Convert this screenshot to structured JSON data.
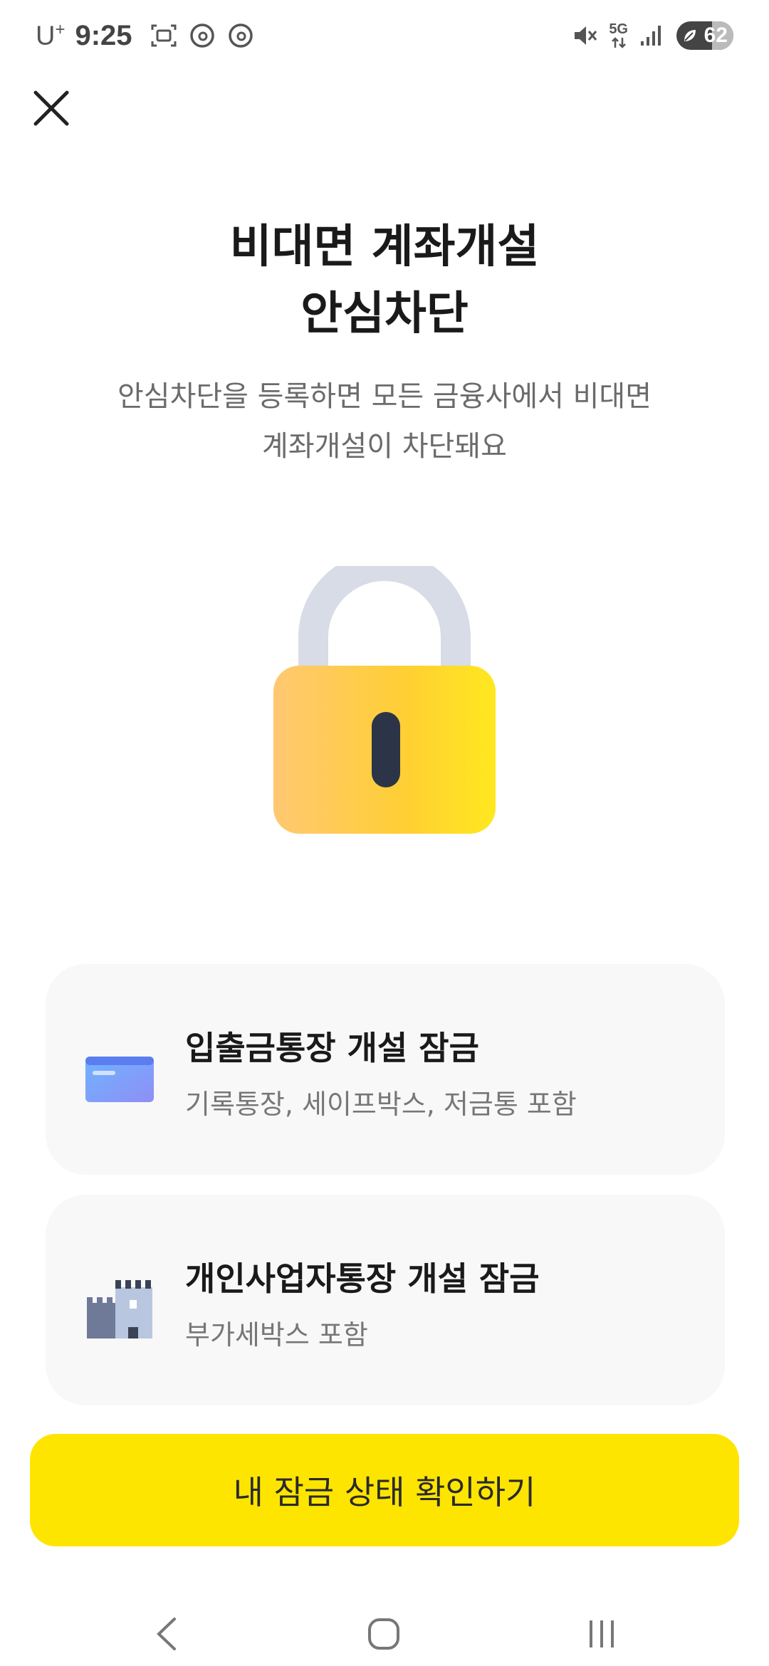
{
  "status_bar": {
    "carrier": "U",
    "carrier_sup": "+",
    "time": "9:25",
    "network": "5G",
    "battery": "62"
  },
  "page": {
    "title_line1": "비대면 계좌개설",
    "title_line2": "안심차단",
    "subtitle_line1": "안심차단을 등록하면 모든 금융사에서 비대면",
    "subtitle_line2": "계좌개설이 차단돼요"
  },
  "options": [
    {
      "title": "입출금통장 개설 잠금",
      "desc": "기록통장, 세이프박스, 저금통 포함",
      "icon": "card-icon"
    },
    {
      "title": "개인사업자통장 개설 잠금",
      "desc": "부가세박스 포함",
      "icon": "building-icon"
    }
  ],
  "cta_label": "내 잠금 상태 확인하기",
  "colors": {
    "accent": "#fee500",
    "card_bg": "#f8f8f8",
    "subtitle": "#6b6b6b"
  }
}
